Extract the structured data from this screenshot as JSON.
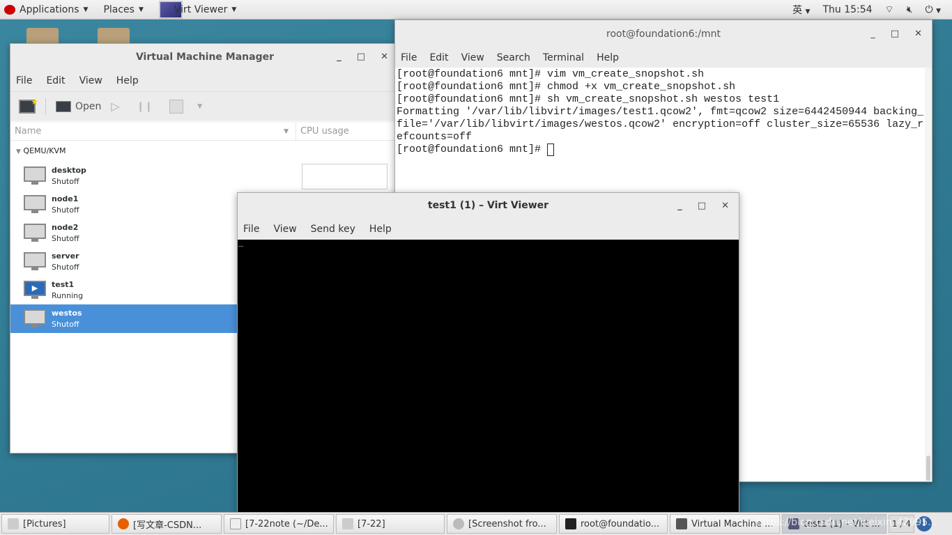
{
  "topbar": {
    "applications": "Applications",
    "places": "Places",
    "active_app": "Virt Viewer",
    "input_method": "英",
    "clock": "Thu 15:54"
  },
  "vmm": {
    "title": "Virtual Machine Manager",
    "menu": [
      "File",
      "Edit",
      "View",
      "Help"
    ],
    "toolbar": {
      "open": "Open"
    },
    "columns": {
      "name": "Name",
      "cpu": "CPU usage"
    },
    "group": "QEMU/KVM",
    "vms": [
      {
        "name": "desktop",
        "status": "Shutoff"
      },
      {
        "name": "node1",
        "status": "Shutoff"
      },
      {
        "name": "node2",
        "status": "Shutoff"
      },
      {
        "name": "server",
        "status": "Shutoff"
      },
      {
        "name": "test1",
        "status": "Running"
      },
      {
        "name": "westos",
        "status": "Shutoff",
        "selected": true
      }
    ]
  },
  "terminal": {
    "title": "root@foundation6:/mnt",
    "menu": [
      "File",
      "Edit",
      "View",
      "Search",
      "Terminal",
      "Help"
    ],
    "lines": [
      "[root@foundation6 mnt]# vim vm_create_snopshot.sh",
      "[root@foundation6 mnt]# chmod +x vm_create_snopshot.sh",
      "[root@foundation6 mnt]# sh vm_create_snopshot.sh westos test1",
      "Formatting '/var/lib/libvirt/images/test1.qcow2', fmt=qcow2 size=6442450944 backing_",
      "file='/var/lib/libvirt/images/westos.qcow2' encryption=off cluster_size=65536 lazy_r",
      "efcounts=off",
      "[root@foundation6 mnt]# "
    ]
  },
  "viewer": {
    "title": "test1 (1) – Virt Viewer",
    "menu": [
      "File",
      "View",
      "Send key",
      "Help"
    ],
    "console_text": "_"
  },
  "taskbar": {
    "items": [
      "[Pictures]",
      "[写文章-CSDN...",
      "[7-22note (~/De...",
      "[7-22]",
      "[Screenshot fro...",
      "root@foundatio...",
      "Virtual Machine ...",
      "test1 (1) – Virt ..."
    ],
    "workspace": "1 / 4",
    "watermark": "https://blog.csdn.net/weixin_42995..."
  },
  "colors": {
    "desktop": "#2f7891",
    "selection": "#4a90d9",
    "console": "#000000"
  }
}
